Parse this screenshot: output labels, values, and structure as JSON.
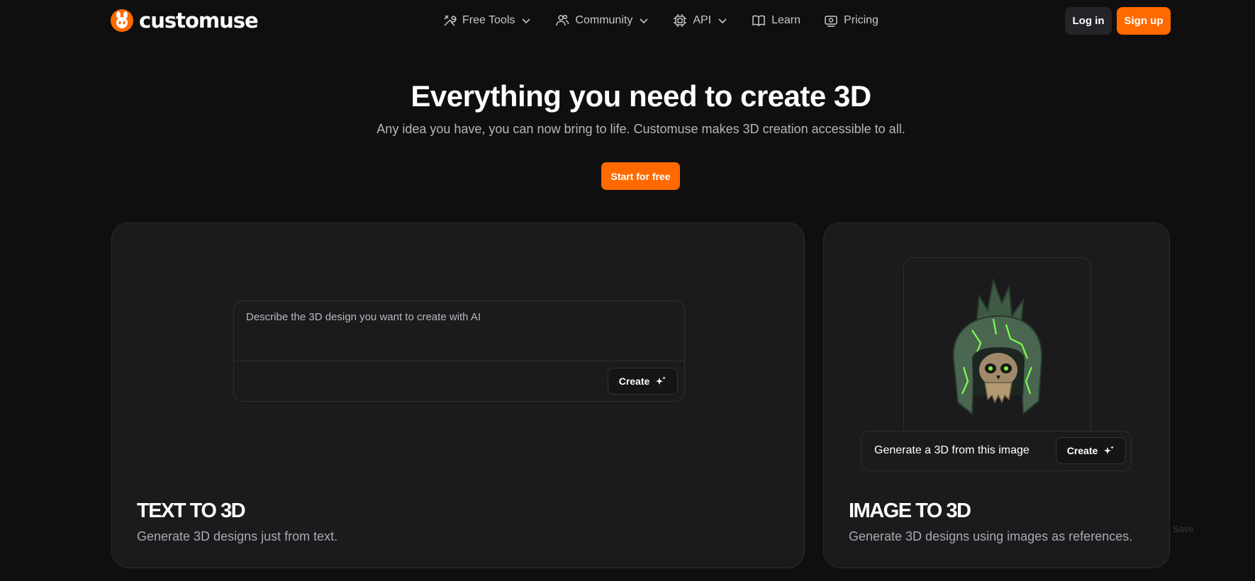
{
  "brand": {
    "name": "customuse",
    "accent": "#ff6a00"
  },
  "nav": {
    "items": [
      {
        "label": "Free Tools",
        "icon": "tools-icon",
        "has_dropdown": true
      },
      {
        "label": "Community",
        "icon": "users-icon",
        "has_dropdown": true
      },
      {
        "label": "API",
        "icon": "chip-icon",
        "has_dropdown": true
      },
      {
        "label": "Learn",
        "icon": "book-icon",
        "has_dropdown": false
      },
      {
        "label": "Pricing",
        "icon": "money-icon",
        "has_dropdown": false
      }
    ],
    "login_label": "Log in",
    "signup_label": "Sign up"
  },
  "hero": {
    "title": "Everything you need to create 3D",
    "subtitle": "Any idea you have, you can now bring to life. Customuse makes 3D creation accessible to all.",
    "cta_label": "Start for free"
  },
  "text_to_3d": {
    "placeholder": "Describe the 3D design you want to create with AI",
    "create_label": "Create",
    "title": "TEXT TO 3D",
    "description": "Generate 3D designs just from text."
  },
  "image_to_3d": {
    "prompt_label": "Generate a 3D from this image",
    "create_label": "Create",
    "title": "IMAGE TO 3D",
    "description": "Generate 3D designs using images as references."
  },
  "save_label": "Save"
}
